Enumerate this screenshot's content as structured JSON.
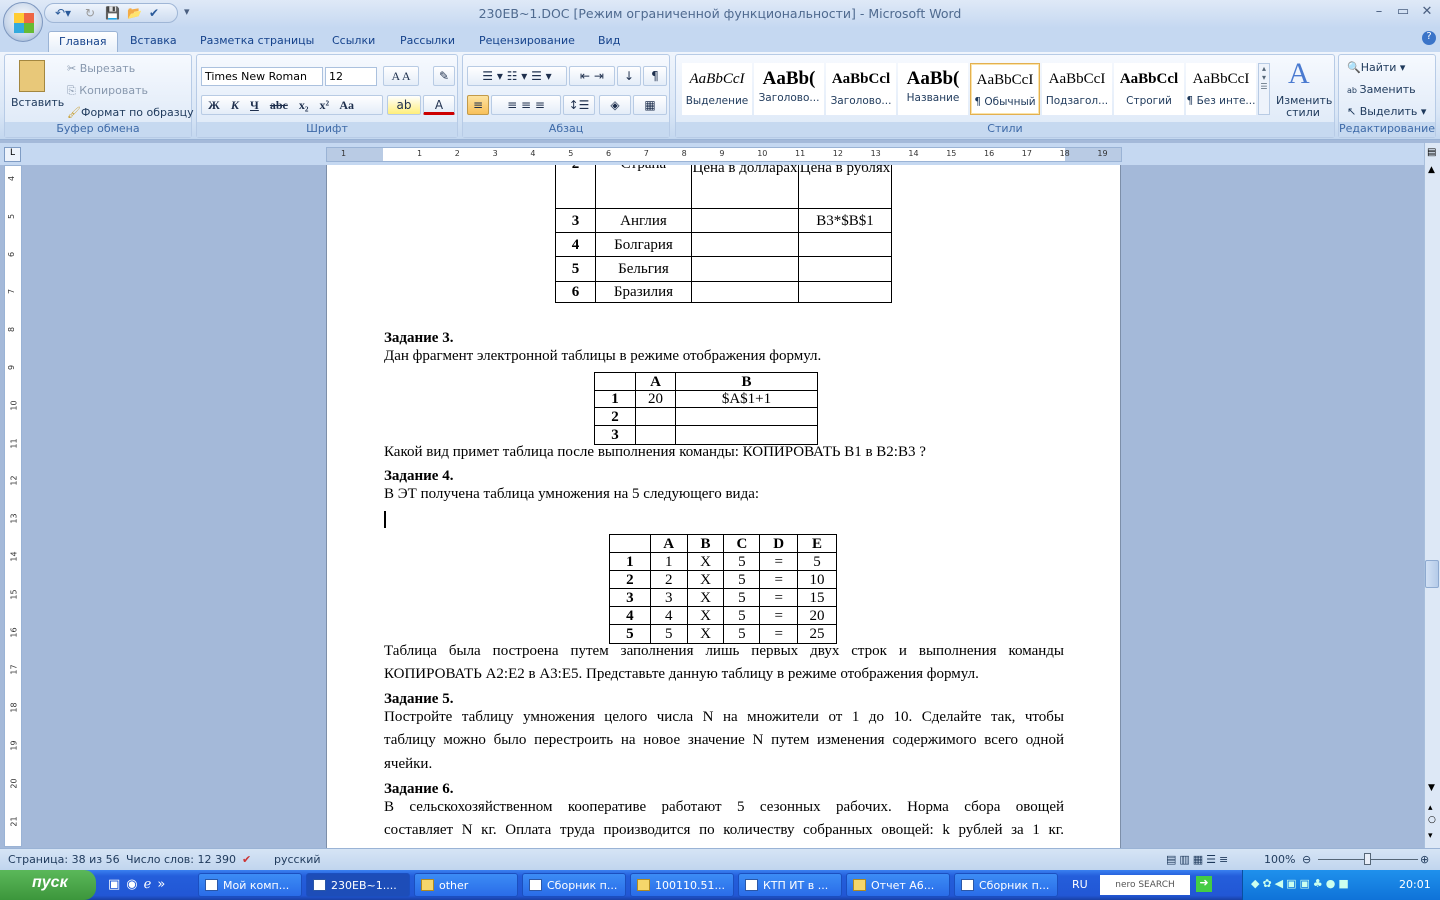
{
  "window": {
    "title": "230EB~1.DOC [Режим ограниченной функциональности] - Microsoft Word",
    "minimize": "–",
    "restore": "▭",
    "close": "✕",
    "help": "?"
  },
  "tabs": [
    "Главная",
    "Вставка",
    "Разметка страницы",
    "Ссылки",
    "Рассылки",
    "Рецензирование",
    "Вид"
  ],
  "clipboard": {
    "paste": "Вставить",
    "cut": "Вырезать",
    "copy": "Копировать",
    "format_painter": "Формат по образцу",
    "label": "Буфер обмена"
  },
  "font": {
    "family": "Times New Roman",
    "size": "12",
    "label": "Шрифт",
    "buttons": [
      "Ж",
      "К",
      "Ч",
      "abc",
      "x₂",
      "x²",
      "Aa"
    ]
  },
  "paragraph": {
    "label": "Абзац"
  },
  "styles": {
    "label": "Стили",
    "items": [
      {
        "preview": "AaBbCcI",
        "name": "Выделение"
      },
      {
        "preview": "AaBb(",
        "name": "Заголово..."
      },
      {
        "preview": "AaBbCcl",
        "name": "Заголово..."
      },
      {
        "preview": "AaBb(",
        "name": "Название"
      },
      {
        "preview": "AaBbCcI",
        "name": "¶ Обычный",
        "selected": true
      },
      {
        "preview": "AaBbCcI",
        "name": "Подзагол..."
      },
      {
        "preview": "AaBbCcl",
        "name": "Строгий"
      },
      {
        "preview": "AaBbCcI",
        "name": "¶ Без инте..."
      }
    ],
    "change": "Изменить стили"
  },
  "editing": {
    "label": "Редактирование",
    "find": "Найти",
    "replace": "Заменить",
    "select": "Выделить"
  },
  "ruler": {
    "h": [
      "1",
      "1",
      "2",
      "3",
      "4",
      "5",
      "6",
      "7",
      "8",
      "9",
      "10",
      "11",
      "12",
      "13",
      "14",
      "15",
      "16",
      "17",
      "18",
      "19"
    ],
    "v": [
      "4",
      "5",
      "6",
      "7",
      "8",
      "9",
      "10",
      "11",
      "12",
      "13",
      "14",
      "15",
      "16",
      "17",
      "18",
      "19",
      "20",
      "21"
    ]
  },
  "doc": {
    "table1": [
      [
        "2",
        "Страна",
        "Цена в долларах",
        "Цена в рублях"
      ],
      [
        "3",
        "Англия",
        "",
        "B3*$B$1"
      ],
      [
        "4",
        "Болгария",
        "",
        ""
      ],
      [
        "5",
        "Бельгия",
        "",
        ""
      ],
      [
        "6",
        "Бразилия",
        "",
        ""
      ]
    ],
    "task3_title": "Задание 3.",
    "task3_text": "Дан фрагмент электронной таблицы в режиме отображения формул.",
    "table2": [
      [
        "",
        "A",
        "B"
      ],
      [
        "1",
        "20",
        "$A$1+1"
      ],
      [
        "2",
        "",
        ""
      ],
      [
        "3",
        "",
        ""
      ]
    ],
    "task3_question": "Какой вид примет таблица после выполнения команды: КОПИРОВАТЬ B1 в B2:B3 ?",
    "task4_title": "Задание 4.",
    "task4_text": "В ЭТ получена таблица умножения на 5 следующего вида:",
    "table3": [
      [
        "",
        "A",
        "B",
        "C",
        "D",
        "E"
      ],
      [
        "1",
        "1",
        "X",
        "5",
        "=",
        "5"
      ],
      [
        "2",
        "2",
        "X",
        "5",
        "=",
        "10"
      ],
      [
        "3",
        "3",
        "X",
        "5",
        "=",
        "15"
      ],
      [
        "4",
        "4",
        "X",
        "5",
        "=",
        "20"
      ],
      [
        "5",
        "5",
        "X",
        "5",
        "=",
        "25"
      ]
    ],
    "task4_p1": "Таблица была построена путем заполнения лишь первых двух строк и выполнения команды",
    "task4_p2": "КОПИРОВАТЬ A2:E2 в A3:E5. Представьте данную таблицу в режиме отображения формул.",
    "task5_title": "Задание 5.",
    "task5_l1": "Постройте таблицу умножения целого числа N на множители от 1 до 10. Сделайте так, чтобы",
    "task5_l2": "таблицу можно было перестроить на новое значение N путем изменения содержимого всего одной",
    "task5_l3": "ячейки.",
    "task6_title": "Задание 6.",
    "task6_l1": "В сельскохозяйственном кооперативе работают 5 сезонных рабочих. Норма сбора овощей",
    "task6_l2": "составляет N кг. Оплата труда производится по количеству собранных овощей: k рублей за 1 кг."
  },
  "status": {
    "page": "Страница: 38 из 56",
    "words": "Число слов: 12 390",
    "language": "русский",
    "zoom": "100%"
  },
  "taskbar": {
    "start": "пуск",
    "items": [
      {
        "label": "Мой комп...",
        "icon": "computer"
      },
      {
        "label": "230EB~1....",
        "icon": "word",
        "active": true
      },
      {
        "label": "other",
        "icon": "folder"
      },
      {
        "label": "Сборник п...",
        "icon": "word"
      },
      {
        "label": "100110.51...",
        "icon": "folder"
      },
      {
        "label": "КТП ИТ в ...",
        "icon": "word"
      },
      {
        "label": "Отчет А6...",
        "icon": "folder"
      },
      {
        "label": "Сборник п...",
        "icon": "word"
      }
    ],
    "lang": "RU",
    "search": "nero SEARCH",
    "clock": "20:01"
  }
}
